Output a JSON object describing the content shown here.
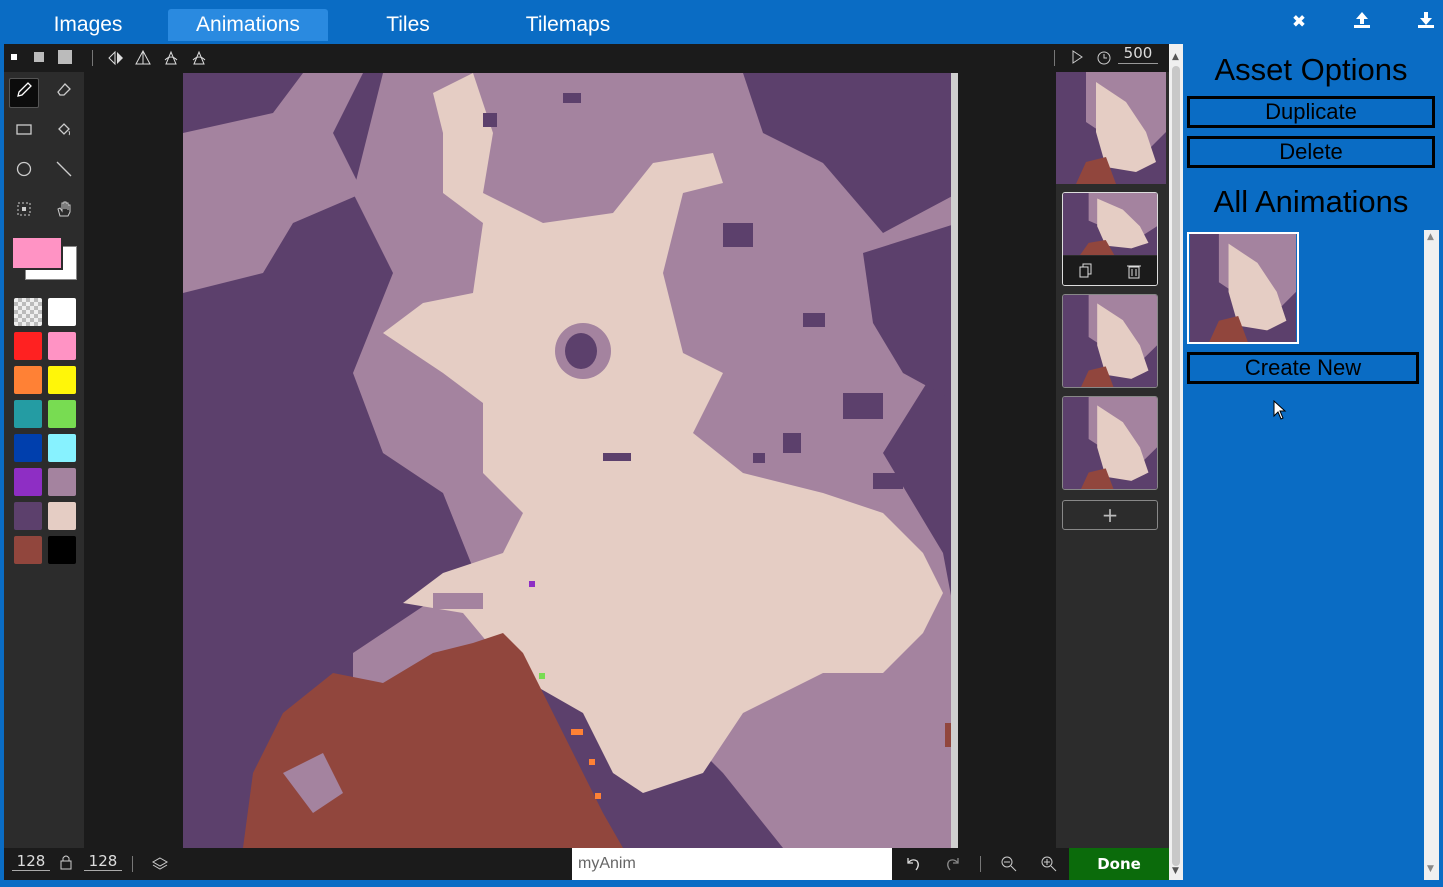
{
  "tabs": [
    {
      "label": "Images",
      "active": false
    },
    {
      "label": "Animations",
      "active": true
    },
    {
      "label": "Tiles",
      "active": false
    },
    {
      "label": "Tilemaps",
      "active": false
    }
  ],
  "top_actions": [
    "close-icon",
    "upload-icon",
    "download-icon"
  ],
  "toolbar": {
    "brush_sizes": [
      "small",
      "medium",
      "large"
    ],
    "transforms": [
      "flip-horizontal-icon",
      "flip-vertical-icon",
      "rotate-cw-icon",
      "rotate-ccw-icon"
    ],
    "play_icon": "play-icon",
    "timer_icon": "clock-icon",
    "interval": "500"
  },
  "tools": [
    "pencil-icon",
    "eraser-icon",
    "rectangle-icon",
    "fill-icon",
    "circle-icon",
    "line-icon",
    "marquee-icon",
    "pan-hand-icon"
  ],
  "colors": {
    "primary": "#ff93c4",
    "secondary": "#ffffff",
    "palette": [
      "transparent",
      "#ffffff",
      "#ff2121",
      "#ff93c4",
      "#ff8135",
      "#fff609",
      "#249ca3",
      "#78dc52",
      "#003fad",
      "#87f2ff",
      "#8e2ec4",
      "#a4839f",
      "#5c406c",
      "#e5cdc4",
      "#91463d",
      "#000000"
    ]
  },
  "frames": {
    "count": 3,
    "copy_icon": "copy-icon",
    "delete_icon": "trash-icon",
    "add_label": "+"
  },
  "bottom": {
    "width": "128",
    "height": "128",
    "name": "myAnim",
    "done_label": "Done"
  },
  "panel": {
    "asset_options_title": "Asset Options",
    "duplicate_label": "Duplicate",
    "delete_label": "Delete",
    "all_animations_title": "All Animations",
    "create_new_label": "Create New"
  }
}
